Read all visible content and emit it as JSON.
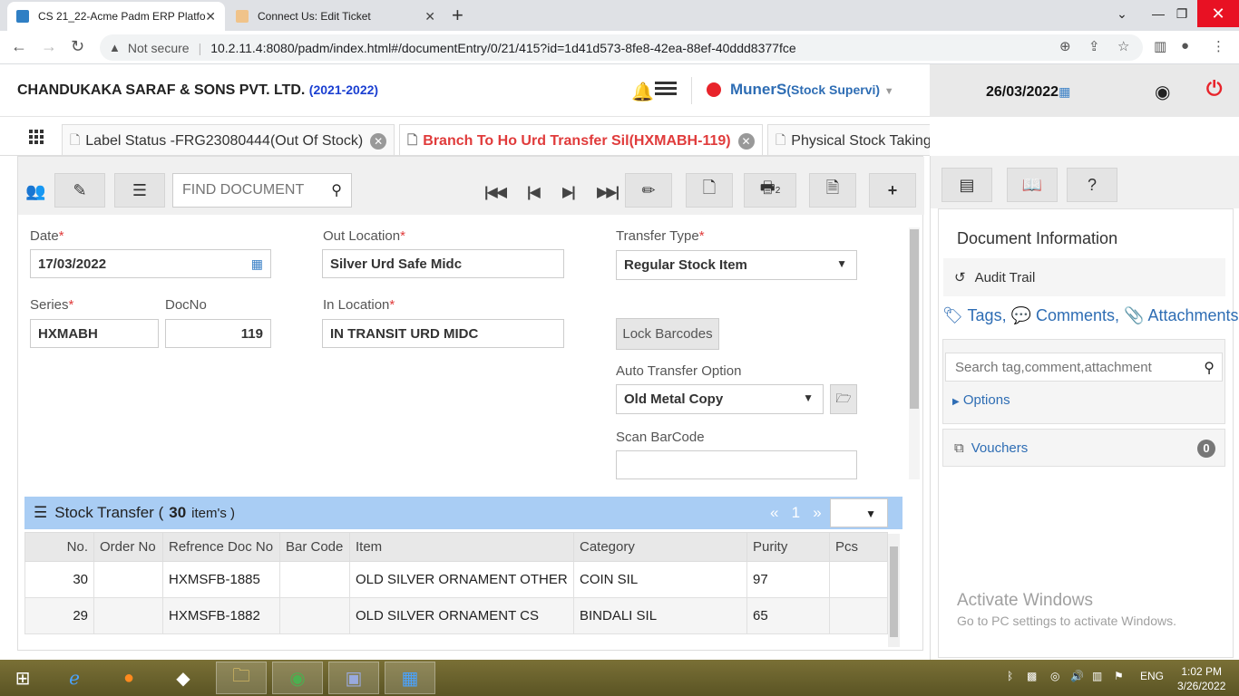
{
  "browser": {
    "tabs": [
      {
        "title": "CS 21_22-Acme Padm ERP Platfo",
        "close": "✕"
      },
      {
        "title": "Connect Us: Edit Ticket",
        "close": "✕"
      }
    ],
    "new_tab": "+",
    "address": {
      "security": "Not secure",
      "url": "10.2.11.4:8080/padm/index.html#/documentEntry/0/21/415?id=1d41d573-8fe8-42ea-88ef-40ddd8377fce"
    }
  },
  "header": {
    "company": "CHANDUKAKA SARAF & SONS PVT. LTD.",
    "year": "(2021-2022)",
    "user_name": "MunerS",
    "user_role": "(Stock Supervi)",
    "date": "26/03/2022"
  },
  "doc_tabs": [
    {
      "label": "Label Status -FRG23080444(Out Of Stock)"
    },
    {
      "label": "Branch To Ho Urd Transfer Sil(HXMABH-119)"
    },
    {
      "label": "Physical Stock Taking"
    }
  ],
  "toolbar": {
    "find_placeholder": "FIND DOCUMENT",
    "print_badge": "2"
  },
  "form": {
    "date_label": "Date",
    "date_value": "17/03/2022",
    "series_label": "Series",
    "series_value": "HXMABH",
    "docno_label": "DocNo",
    "docno_value": "119",
    "out_location_label": "Out Location",
    "out_location_value": "Silver Urd Safe Midc",
    "in_location_label": "In Location",
    "in_location_value": "IN TRANSIT URD MIDC",
    "transfer_type_label": "Transfer Type",
    "transfer_type_value": "Regular Stock Item",
    "lock_barcodes": "Lock Barcodes",
    "auto_transfer_label": "Auto Transfer Option",
    "auto_transfer_value": "Old Metal Copy",
    "scan_barcode_label": "Scan BarCode",
    "required_mark": "*"
  },
  "stock_transfer": {
    "title": "Stock Transfer (",
    "count": "30",
    "items_suffix": "item's )",
    "pager_prev": "«",
    "pager_page": "1",
    "pager_next": "»",
    "columns": [
      "No.",
      "Order No",
      "Refrence Doc No",
      "Bar Code",
      "Item",
      "Category",
      "Purity",
      "Pcs"
    ],
    "rows": [
      {
        "no": "30",
        "order_no": "",
        "ref_doc": "HXMSFB-1885",
        "bar_code": "",
        "item": "OLD SILVER ORNAMENT OTHER",
        "category": "COIN SIL",
        "purity": "97",
        "pcs": ""
      },
      {
        "no": "29",
        "order_no": "",
        "ref_doc": "HXMSFB-1882",
        "bar_code": "",
        "item": "OLD SILVER ORNAMENT CS",
        "category": "BINDALI SIL",
        "purity": "65",
        "pcs": ""
      }
    ]
  },
  "right_panel": {
    "title": "Document Information",
    "audit_trail": "Audit Trail",
    "tags": "Tags,",
    "comments": "Comments,",
    "attachments": "Attachments",
    "search_placeholder": "Search tag,comment,attachment",
    "options": "Options",
    "vouchers": "Vouchers",
    "vouchers_count": "0",
    "activate_title": "Activate Windows",
    "activate_sub": "Go to PC settings to activate Windows."
  },
  "taskbar": {
    "lang": "ENG",
    "time": "1:02 PM",
    "date": "3/26/2022"
  },
  "colors": {
    "accent_blue": "#2e6db4",
    "active_tab_red": "#e03b3b",
    "grid_header_blue": "#a9cdf4",
    "status_red": "#e8242b"
  }
}
